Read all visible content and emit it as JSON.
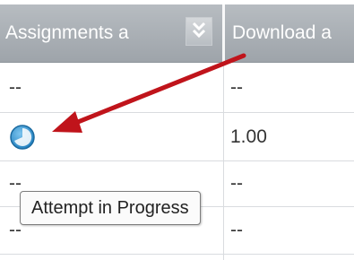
{
  "table": {
    "columns": [
      {
        "label": "Assignments a"
      },
      {
        "label": "Download a"
      }
    ],
    "rows": [
      {
        "assignment": "--",
        "download": "--"
      },
      {
        "assignment": "",
        "download": "1.00"
      },
      {
        "assignment": "--",
        "download": "--"
      },
      {
        "assignment": "--",
        "download": "--"
      }
    ]
  },
  "tooltip": {
    "text": "Attempt in Progress"
  },
  "colors": {
    "header_bg": "#a9aeb3",
    "link": "#1f6fa8",
    "status_icon": "#2e8ec9",
    "arrow": "#c0141b"
  },
  "icons": {
    "status": "attempt-in-progress-icon",
    "sort": "sort-chevron-icon"
  }
}
